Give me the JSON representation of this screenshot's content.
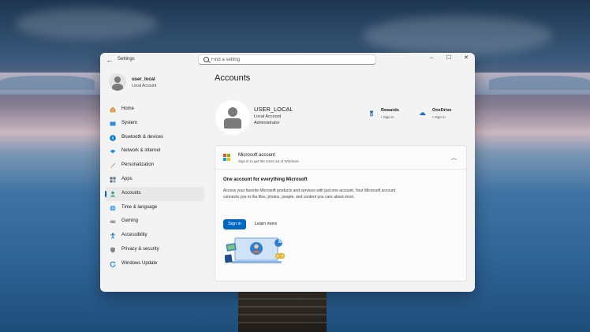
{
  "window": {
    "app_title": "Settings",
    "search_placeholder": "Find a setting",
    "controls": {
      "minimize": "–",
      "maximize": "☐",
      "close": "✕"
    }
  },
  "sidebar": {
    "user_name": "user_local",
    "account_type": "Local Account",
    "items": [
      {
        "label": "Home",
        "icon": "home-icon",
        "color": "#d9822b"
      },
      {
        "label": "System",
        "icon": "system-icon",
        "color": "#0078d4"
      },
      {
        "label": "Bluetooth & devices",
        "icon": "bluetooth-icon",
        "color": "#0078d4"
      },
      {
        "label": "Network & internet",
        "icon": "network-icon",
        "color": "#0078d4"
      },
      {
        "label": "Personalization",
        "icon": "brush-icon",
        "color": "#c25b3a"
      },
      {
        "label": "Apps",
        "icon": "apps-icon",
        "color": "#5a6b7c"
      },
      {
        "label": "Accounts",
        "icon": "accounts-icon",
        "color": "#2ea37a",
        "active": true
      },
      {
        "label": "Time & language",
        "icon": "globe-icon",
        "color": "#0078d4"
      },
      {
        "label": "Gaming",
        "icon": "gamepad-icon",
        "color": "#6b7780"
      },
      {
        "label": "Accessibility",
        "icon": "accessibility-icon",
        "color": "#0067c0"
      },
      {
        "label": "Privacy & security",
        "icon": "shield-icon",
        "color": "#6b7780"
      },
      {
        "label": "Windows Update",
        "icon": "update-icon",
        "color": "#0078d4"
      }
    ]
  },
  "main": {
    "page_title": "Accounts",
    "user": {
      "name": "USER_LOCAL",
      "type": "Local Account",
      "role": "Administrator"
    },
    "rewards": {
      "title": "Rewards",
      "sub": "• Sign in"
    },
    "onedrive": {
      "title": "OneDrive",
      "sub": "• Sign in"
    },
    "ms_account": {
      "title": "Microsoft account",
      "subtitle": "Sign in to get the most out of Windows",
      "promo_title": "One account for everything Microsoft",
      "promo_text": "Access your favorite Microsoft products and services with just one account. Your Microsoft account connects you to the files, photos, people, and content you care about most.",
      "signin_label": "Sign in",
      "learn_more_label": "Learn more"
    }
  },
  "colors": {
    "accent": "#0067c0"
  }
}
